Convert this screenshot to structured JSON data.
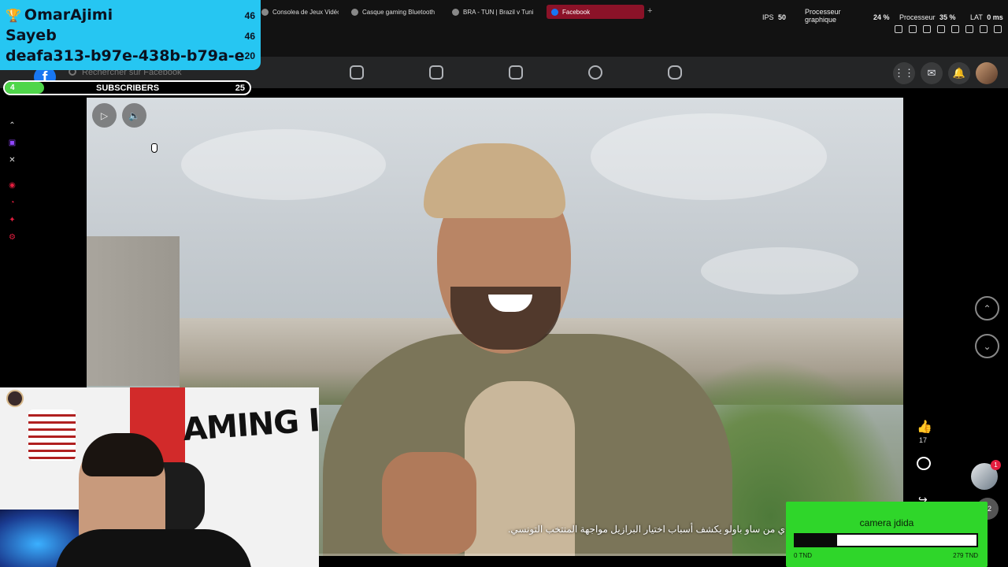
{
  "browser": {
    "tabs": [
      {
        "label": "Consolea de Jeux Vidéo e"
      },
      {
        "label": "Casque gaming Bluetooth"
      },
      {
        "label": "BRA - TUN | Brazil v Tuni"
      },
      {
        "label": "Facebook",
        "active": true
      }
    ],
    "add_tab": "+",
    "stats": {
      "ips_label": "IPS",
      "ips_value": "50",
      "gpu_label": "Processeur graphique",
      "gpu_value": "24 %",
      "cpu_label": "Processeur",
      "cpu_value": "35 %",
      "lat_label": "LAT",
      "lat_value": "0 ms"
    }
  },
  "facebook": {
    "logo": "f",
    "search_placeholder": "Rechercher sur Facebook",
    "nav": [
      "home-icon",
      "video-icon",
      "marketplace-icon",
      "groups-icon",
      "gaming-icon"
    ],
    "right_buttons": [
      "menu-grid-icon",
      "messenger-icon",
      "bell-icon"
    ]
  },
  "video": {
    "caption": "ي من ساو باولو يكشف أسباب اختيار البرازيل مواجهة المنتخب التونسي.",
    "play_icon": "▷",
    "volume_icon": "🔈",
    "like_count": "17",
    "notif_count": "1",
    "secondary_count": "2"
  },
  "leaderboard": {
    "rows": [
      {
        "name": "OmarAjimi",
        "count": "46"
      },
      {
        "name": "Sayeb",
        "count": "46"
      },
      {
        "name": "deafa313-b97e-438b-b79a-e",
        "count": "20"
      }
    ]
  },
  "subscribers": {
    "label": "SUBSCRIBERS",
    "current": "4",
    "goal": "25",
    "progress": 0.16
  },
  "donation": {
    "title": "camera jdida",
    "min": "0 TND",
    "max": "279 TND",
    "progress": 0.23
  },
  "colors": {
    "leaderboard_bg": "#26c6f2",
    "subs_fill": "#4fd64a",
    "donation_bg": "#2fd62a",
    "facebook_blue": "#1877f2",
    "active_tab": "#8b1228"
  }
}
